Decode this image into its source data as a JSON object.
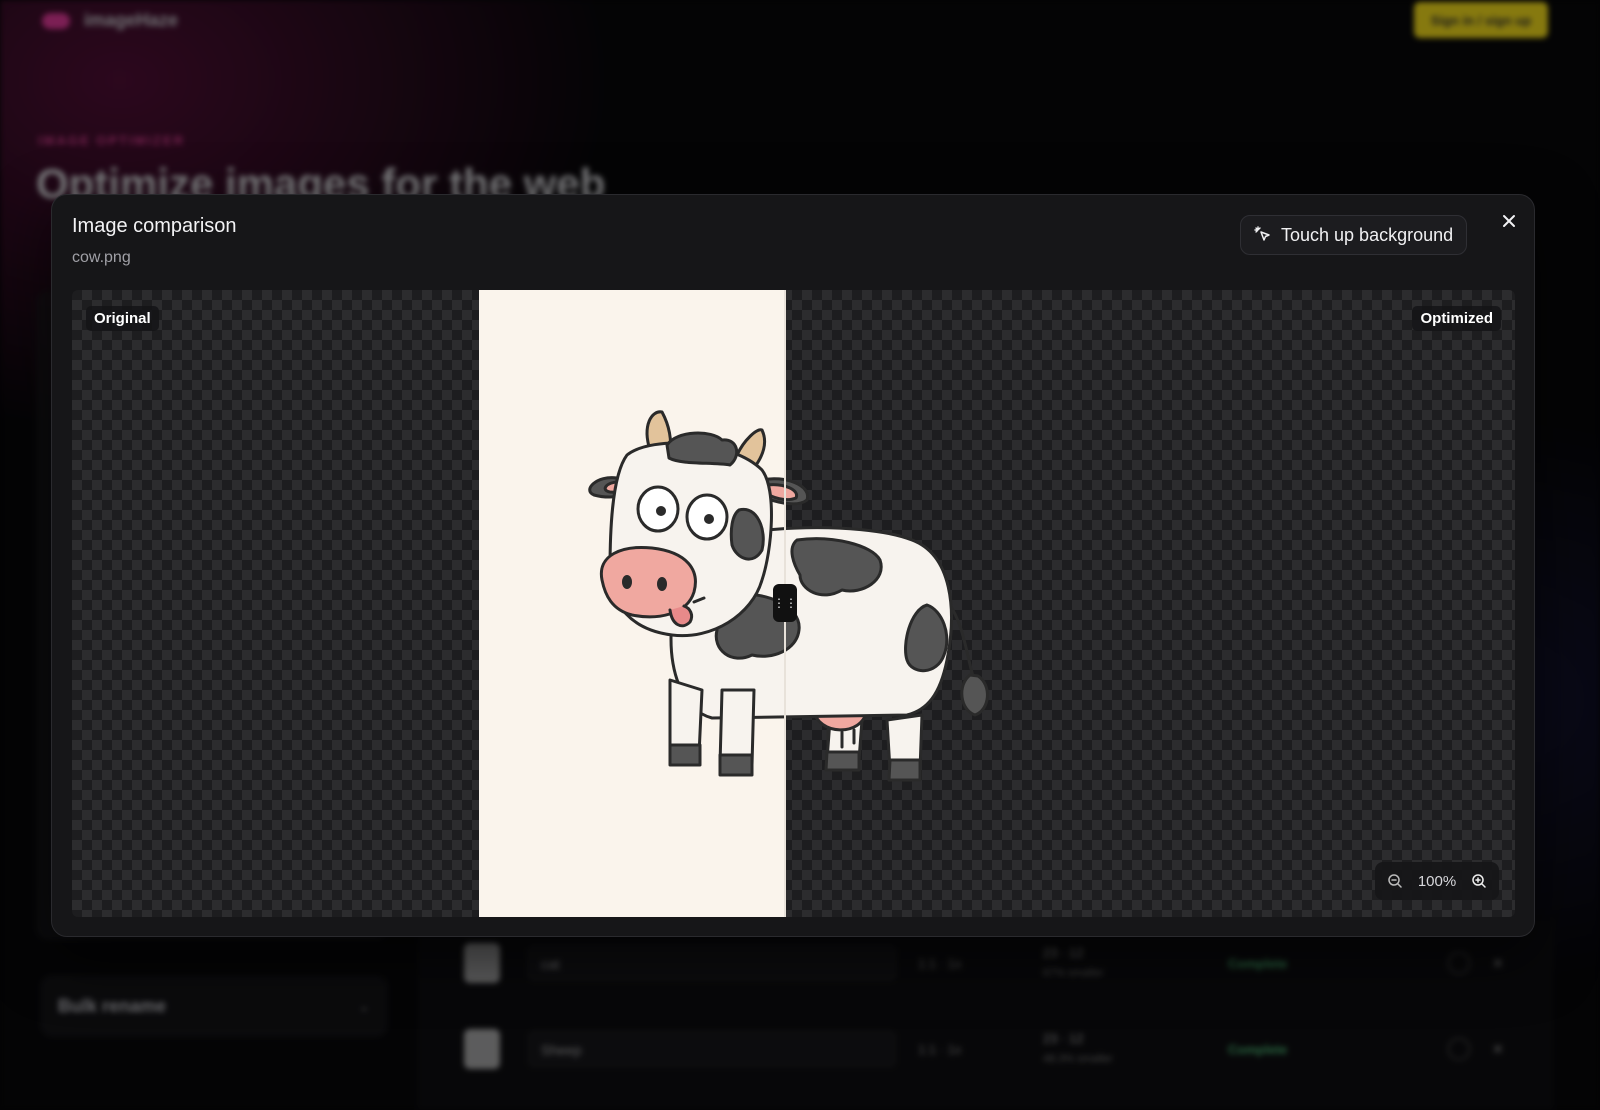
{
  "background": {
    "logo_text": "imageHaze",
    "signin_label": "Sign in / sign up",
    "eyebrow": "IMAGE OPTIMIZER",
    "title": "Optimize images for the web",
    "bulk_rename_label": "Bulk rename",
    "rows": [
      {
        "name": "cat",
        "format": "1:1 · 1x",
        "size": "23 · 12",
        "size_sub": "67% smaller",
        "status": "Complete"
      },
      {
        "name": "Sheep",
        "format": "1:1 · 1x",
        "size": "23 · 12",
        "size_sub": "48.3% smaller",
        "status": "Complete"
      }
    ]
  },
  "modal": {
    "title": "Image comparison",
    "filename": "cow.png",
    "touch_up_label": "Touch up background",
    "label_original": "Original",
    "label_optimized": "Optimized",
    "zoom_value": "100%",
    "divider_position": 0.495
  },
  "colors": {
    "accent_pink": "#e23a9a",
    "signin_yellow": "#f5dd1c",
    "status_green": "#4dbb76"
  },
  "icons": {
    "touch_up": "cursor-sparkle-icon",
    "close": "close-icon",
    "zoom_out": "zoom-out-icon",
    "zoom_in": "zoom-in-icon",
    "handle": "drag-handle-icon"
  }
}
